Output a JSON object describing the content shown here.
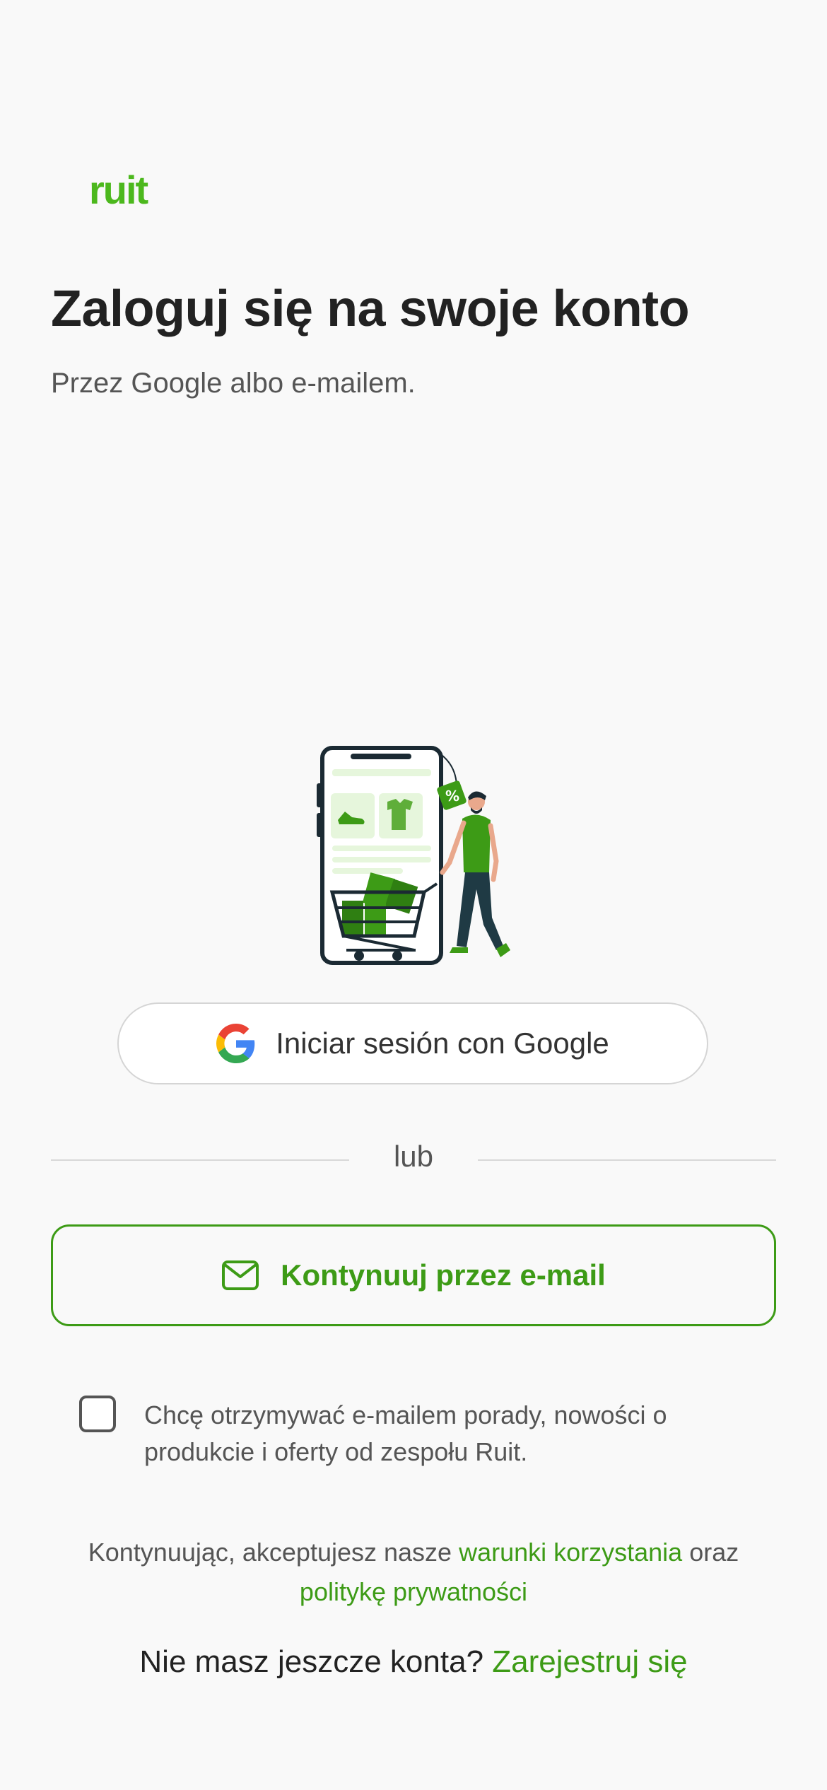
{
  "brand": {
    "logo_text": "ruit",
    "accent": "#3d9b16"
  },
  "header": {
    "title": "Zaloguj się na swoje konto",
    "subtitle": "Przez Google albo e-mailem."
  },
  "illustration": {
    "name": "shopping-illustration",
    "badge": "%"
  },
  "google_button": {
    "label": "Iniciar sesión con Google",
    "icon": "google-icon"
  },
  "divider": {
    "label": "lub"
  },
  "email_button": {
    "label": "Kontynuuj przez e-mail",
    "icon": "mail-icon"
  },
  "newsletter": {
    "checked": false,
    "label": "Chcę otrzymywać e-mailem porady, nowości o produkcie i oferty od zespołu Ruit."
  },
  "legal": {
    "prefix": "Kontynuując, akceptujesz nasze",
    "terms_link": "warunki korzystania",
    "connector": "oraz",
    "privacy_link": "politykę prywatności"
  },
  "signup": {
    "prompt": "Nie masz jeszcze konta?",
    "link": "Zarejestruj się"
  }
}
